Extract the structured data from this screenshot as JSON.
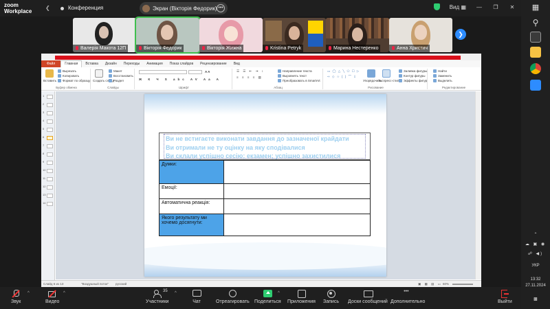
{
  "zoom": {
    "logo_line1": "zoom",
    "logo_line2": "Workplace",
    "meeting_title": "Конференция",
    "share_label": "Экран (Вікторія Федорик)",
    "view_label": "Вид",
    "colors": {
      "accent": "#2d8cff",
      "active_speaker": "#3fbf4e",
      "muted": "#e22d44"
    }
  },
  "participants": [
    {
      "name": "Валерія Макота 12П",
      "muted": true
    },
    {
      "name": "Вікторія Федорик",
      "muted": true,
      "active": true
    },
    {
      "name": "Вікторія Жижна",
      "muted": true
    },
    {
      "name": "Kristina Petryk",
      "muted": true
    },
    {
      "name": "Марина Нестеренко",
      "muted": true
    },
    {
      "name": "Анна Христич",
      "muted": true
    }
  ],
  "powerpoint": {
    "tabs": [
      "Файл",
      "Главная",
      "Вставка",
      "Дизайн",
      "Переходы",
      "Анимация",
      "Показ слайдов",
      "Рецензирование",
      "Вид"
    ],
    "active_tab": "Главная",
    "groups": [
      "Буфер обмена",
      "Слайды",
      "Шрифт",
      "Абзац",
      "Рисование",
      "Редактирование"
    ],
    "clipboard": {
      "paste": "Вставить",
      "cut": "Вырезать",
      "copy": "Копировать",
      "format": "Формат по образцу"
    },
    "slides_group": {
      "new": "Создать слайд",
      "layout": "Макет",
      "reset": "Восстановить",
      "section": "Раздел"
    },
    "drawing": {
      "arrange": "Упорядочить",
      "quick_styles": "Экспресс-стили",
      "fill": "Заливка фигуры",
      "outline": "Контур фигуры",
      "effects": "Эффекты фигур"
    },
    "editing": {
      "find": "Найти",
      "replace": "Заменить",
      "select": "Выделить"
    },
    "paragraph": {
      "direction": "Направление текста",
      "align": "Выровнять текст",
      "smartart": "Преобразовать в SmartArt"
    },
    "thumb_count": 14,
    "status": {
      "slide": "Слайд 6 из 13",
      "theme": "\"Воздушный поток\"",
      "lang": "русский",
      "zoom": "60%"
    }
  },
  "slide": {
    "heading_lines": [
      "Ви не встигаєте виконати завдання до зазначеної крайдати",
      "Ви отримали не ту оцінку на яку сподівалися",
      "Ви склали успішно сесію; екзамен; успішно захистилися"
    ],
    "rows": [
      {
        "label": "Думки:",
        "value": ""
      },
      {
        "label": "Емоції:",
        "value": ""
      },
      {
        "label": "Автоматична реакція:",
        "value": ""
      },
      {
        "label": "Якого результату ми хочемо досягнути:",
        "value": ""
      }
    ]
  },
  "toolbar": {
    "audio": "Звук",
    "video": "Видео",
    "participants": "Участники",
    "participants_count": "35",
    "chat": "Чат",
    "react": "Отреагировать",
    "share": "Поделиться",
    "apps": "Приложения",
    "record": "Запись",
    "whiteboards": "Доски сообщений",
    "more": "Дополнительно",
    "leave": "Выйти"
  },
  "taskbar": {
    "lang": "УКР",
    "time": "13:32",
    "date": "27.11.2024"
  }
}
